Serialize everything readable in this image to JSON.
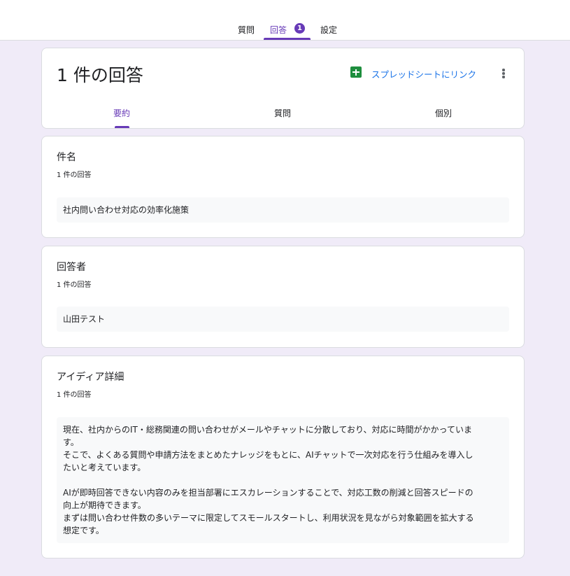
{
  "top_tabs": {
    "questions": "質問",
    "responses": "回答",
    "responses_badge": "1",
    "settings": "設定"
  },
  "header": {
    "title": "1 件の回答",
    "sheets_link": "スプレッドシートにリンク",
    "subtabs": {
      "summary": "要約",
      "question": "質問",
      "individual": "個別"
    }
  },
  "questions": [
    {
      "title": "件名",
      "count": "1 件の回答",
      "answer_lines": [
        "社内問い合わせ対応の効率化施策"
      ]
    },
    {
      "title": "回答者",
      "count": "1 件の回答",
      "answer_lines": [
        "山田テスト"
      ]
    },
    {
      "title": "アイディア詳細",
      "count": "1 件の回答",
      "answer_lines": [
        "現在、社内からのIT・総務関連の問い合わせがメールやチャットに分散しており、対応に時間がかかっていま",
        "す。",
        "そこで、よくある質問や申請方法をまとめたナレッジをもとに、AIチャットで一次対応を行う仕組みを導入し",
        "たいと考えています。",
        "",
        "AIが即時回答できない内容のみを担当部署にエスカレーションすることで、対応工数の削減と回答スピードの",
        "向上が期待できます。",
        "まずは問い合わせ件数の多いテーマに限定してスモールスタートし、利用状況を見ながら対象範囲を拡大する",
        "想定です。"
      ]
    }
  ],
  "colors": {
    "accent": "#673ab7",
    "background": "#f0ebf8",
    "link": "#1a73e8",
    "sheets_green": "#1e8e3e",
    "answer_bg": "#f8f9fa"
  },
  "icons": [
    "sheets-icon",
    "more-vert-icon"
  ]
}
